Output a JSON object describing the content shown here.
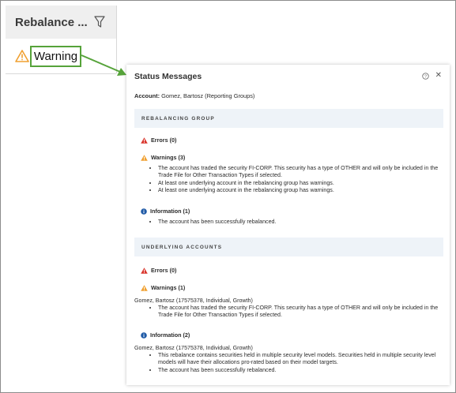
{
  "column": {
    "header_title": "Rebalance ...",
    "cell_value": "Warning"
  },
  "panel": {
    "title": "Status Messages",
    "account_label": "Account:",
    "account_value": "Gomez, Bartosz (Reporting Groups)",
    "sections": {
      "rebalancing_group": {
        "label": "REBALANCING GROUP",
        "errors": "Errors (0)",
        "warnings": "Warnings (3)",
        "warning_items": [
          "The account has traded the security FI-CORP. This security has a type of OTHER and will only be included in the Trade File for Other Transaction Types if selected.",
          "At least one underlying account in the rebalancing group has warnings.",
          "At least one underlying account in the rebalancing group has warnings."
        ],
        "information": "Information (1)",
        "information_items": [
          "The account has been successfully rebalanced."
        ]
      },
      "underlying_accounts": {
        "label": "UNDERLYING ACCOUNTS",
        "errors": "Errors (0)",
        "warnings": "Warnings (1)",
        "warning_account": "Gomez, Bartosz (17575378, Individual, Growth)",
        "warning_items": [
          "The account has traded the security FI-CORP. This security has a type of OTHER and will only be included in the Trade File for Other Transaction Types if selected."
        ],
        "information": "Information (2)",
        "information_account": "Gomez, Bartosz (17575378, Individual, Growth)",
        "information_items": [
          "This rebalance contains securities held in multiple security level models. Securities held in multiple security level models will have their allocations pro-rated based on their model targets.",
          "The account has been successfully rebalanced."
        ]
      }
    }
  },
  "colors": {
    "error": "#d9342b",
    "warning": "#f0a030",
    "info": "#1f5aa6",
    "highlight": "#56a33a",
    "section_bg": "#eef3f8"
  },
  "icons": {
    "filter": "filter-icon",
    "warning": "warning-triangle-icon",
    "error": "error-triangle-icon",
    "info": "info-circle-icon",
    "help": "help-icon",
    "close": "close-icon"
  }
}
